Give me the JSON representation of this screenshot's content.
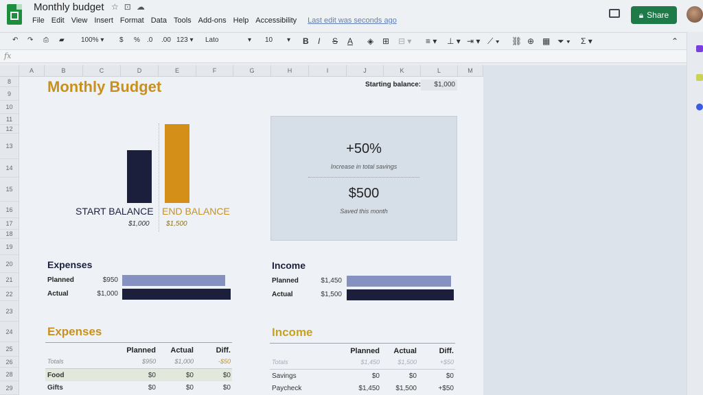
{
  "app": {
    "doc_title": "Monthly budget",
    "menu": [
      "File",
      "Edit",
      "View",
      "Insert",
      "Format",
      "Data",
      "Tools",
      "Add-ons",
      "Help",
      "Accessibility"
    ],
    "last_edit": "Last edit was seconds ago",
    "share_label": "Share"
  },
  "toolbar": {
    "zoom": "100%",
    "currency": "$",
    "percent": "%",
    "dec_less": ".0",
    "dec_more": ".00",
    "more_formats": "123",
    "font": "Lato",
    "font_size": "10",
    "bold": "B",
    "italic": "I",
    "strike": "S",
    "text_color": "A",
    "sum": "Σ"
  },
  "formula_bar": {
    "fx": "fx"
  },
  "columns": [
    "A",
    "B",
    "C",
    "D",
    "E",
    "F",
    "G",
    "H",
    "I",
    "J",
    "K",
    "L",
    "M"
  ],
  "rows": [
    "8",
    "9",
    "10",
    "11",
    "12",
    "13",
    "14",
    "15",
    "16",
    "17",
    "18",
    "19",
    "20",
    "21",
    "22",
    "23",
    "24",
    "25",
    "26",
    "28",
    "29"
  ],
  "sheet": {
    "title": "Monthly Budget",
    "starting_balance_label": "Starting balance:",
    "starting_balance": "$1,000",
    "chart": {
      "start_label": "START BALANCE",
      "end_label": "END BALANCE",
      "start_value": "$1,000",
      "end_value": "$1,500"
    },
    "summary": {
      "savings_pct": "+50%",
      "savings_pct_caption": "Increase in total savings",
      "saved": "$500",
      "saved_caption": "Saved this month"
    },
    "expenses_mini": {
      "title": "Expenses",
      "planned_label": "Planned",
      "planned_value": "$950",
      "actual_label": "Actual",
      "actual_value": "$1,000"
    },
    "income_mini": {
      "title": "Income",
      "planned_label": "Planned",
      "planned_value": "$1,450",
      "actual_label": "Actual",
      "actual_value": "$1,500"
    },
    "expenses_table": {
      "title": "Expenses",
      "headers": [
        "Planned",
        "Actual",
        "Diff."
      ],
      "totals": {
        "label": "Totals",
        "planned": "$950",
        "actual": "$1,000",
        "diff": "-$50"
      },
      "rows": [
        {
          "name": "Food",
          "planned": "$0",
          "actual": "$0",
          "diff": "$0"
        },
        {
          "name": "Gifts",
          "planned": "$0",
          "actual": "$0",
          "diff": "$0"
        }
      ]
    },
    "income_table": {
      "title": "Income",
      "headers": [
        "Planned",
        "Actual",
        "Diff."
      ],
      "totals": {
        "label": "Totals",
        "planned": "$1,450",
        "actual": "$1,500",
        "diff": "+$50"
      },
      "rows": [
        {
          "name": "Savings",
          "planned": "$0",
          "actual": "$0",
          "diff": "$0"
        },
        {
          "name": "Paycheck",
          "planned": "$1,450",
          "actual": "$1,500",
          "diff": "+$50"
        }
      ]
    }
  },
  "chart_data": {
    "type": "bar",
    "categories": [
      "START BALANCE",
      "END BALANCE"
    ],
    "values": [
      1000,
      1500
    ]
  },
  "colors": {
    "accent_gold": "#c8901d",
    "navy": "#1b1f3b",
    "planned_bar": "#8591c0",
    "share_green": "#1e7b49"
  }
}
